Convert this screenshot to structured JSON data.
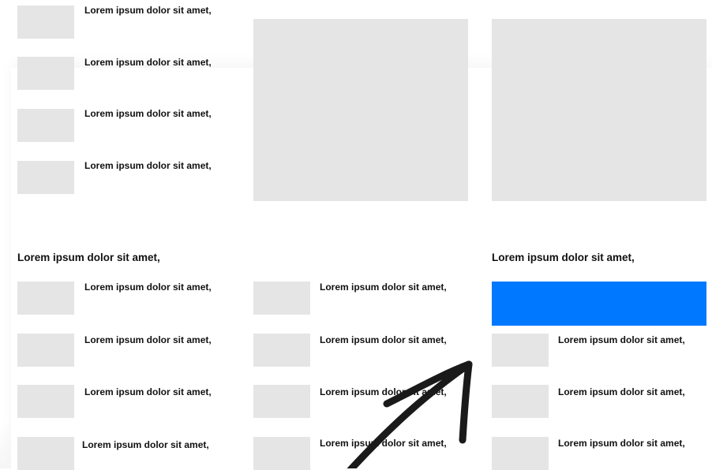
{
  "top_list": {
    "items": [
      {
        "label": "Lorem ipsum dolor sit amet,"
      },
      {
        "label": "Lorem ipsum dolor sit amet,"
      },
      {
        "label": "Lorem ipsum dolor sit amet,"
      },
      {
        "label": "Lorem ipsum dolor sit amet,"
      }
    ]
  },
  "left_column": {
    "title": "Lorem ipsum dolor sit amet,",
    "items": [
      {
        "label": "Lorem ipsum dolor sit amet,"
      },
      {
        "label": "Lorem ipsum dolor sit amet,"
      },
      {
        "label": "Lorem ipsum dolor sit amet,"
      },
      {
        "label": "Lorem ipsum dolor sit amet,"
      }
    ]
  },
  "middle_column": {
    "items": [
      {
        "label": "Lorem ipsum dolor sit amet,"
      },
      {
        "label": "Lorem ipsum dolor sit amet,"
      },
      {
        "label": "Lorem ipsum dolor sit amet,"
      },
      {
        "label": "Lorem ipsum dolor sit amet,"
      }
    ]
  },
  "right_column": {
    "title": "Lorem ipsum dolor sit amet,",
    "items": [
      {
        "label": "Lorem ipsum dolor sit amet,"
      },
      {
        "label": "Lorem ipsum dolor sit amet,"
      },
      {
        "label": "Lorem ipsum dolor sit amet,"
      }
    ]
  },
  "colors": {
    "accent": "#0078ff",
    "placeholder": "#e5e5e5",
    "arrow": "#1a1a1a"
  },
  "icons": {
    "annotation": "hand-drawn-arrow-icon"
  }
}
